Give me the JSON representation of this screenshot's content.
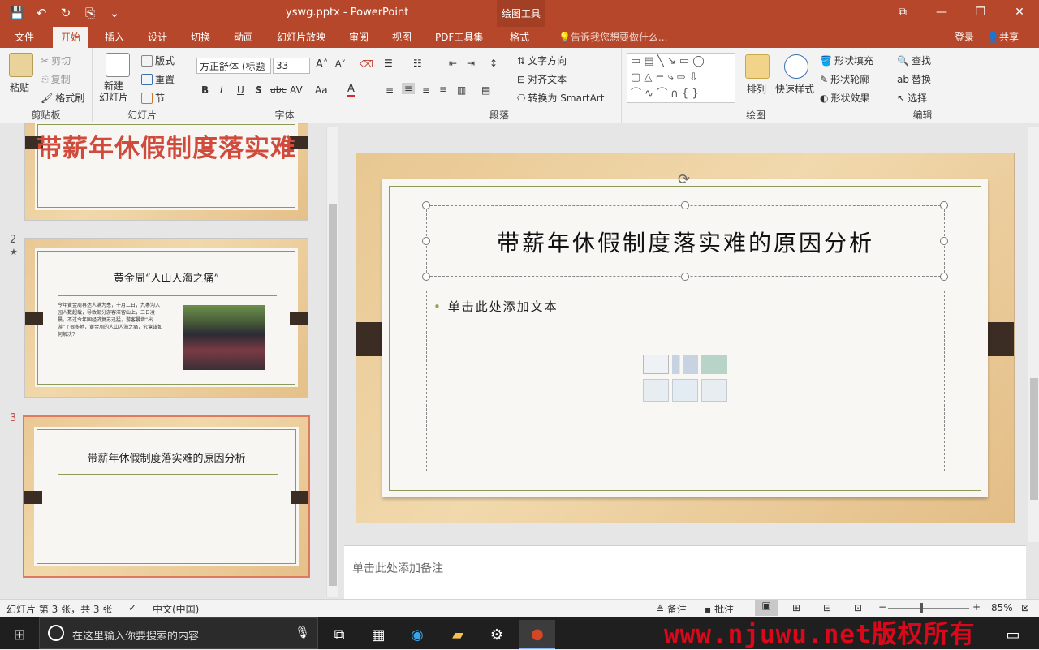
{
  "window": {
    "title": "yswg.pptx - PowerPoint",
    "context_tool": "绘图工具",
    "qat": [
      "💾",
      "↶",
      "↻",
      "⎘",
      "⌄"
    ],
    "controls": [
      "⧉",
      "—",
      "❐",
      "✕"
    ]
  },
  "tabs": [
    "文件",
    "开始",
    "插入",
    "设计",
    "切换",
    "动画",
    "幻灯片放映",
    "审阅",
    "视图",
    "PDF工具集",
    "格式"
  ],
  "active_tab": "开始",
  "tellme": "告诉我您想要做什么...",
  "login": "登录",
  "share": "共享",
  "ribbon": {
    "clipboard": {
      "label": "剪贴板",
      "paste": "粘贴",
      "cut": "剪切",
      "copy": "复制",
      "format_painter": "格式刷"
    },
    "slides": {
      "label": "幻灯片",
      "new_slide": "新建\n幻灯片",
      "layout": "版式",
      "reset": "重置",
      "section": "节"
    },
    "font": {
      "label": "字体",
      "font_name": "方正舒体 (标题",
      "font_size": "33",
      "bold": "B",
      "italic": "I",
      "underline": "U",
      "shadow": "S",
      "strike": "abc",
      "spacing": "AV",
      "case": "Aa",
      "color": "A"
    },
    "paragraph": {
      "label": "段落",
      "text_direction": "文字方向",
      "align_text": "对齐文本",
      "convert_smartart": "转换为 SmartArt"
    },
    "drawing": {
      "label": "绘图",
      "arrange": "排列",
      "quick_styles": "快速样式",
      "shape_fill": "形状填充",
      "shape_outline": "形状轮廓",
      "shape_effects": "形状效果"
    },
    "editing": {
      "label": "编辑",
      "find": "查找",
      "replace": "替换",
      "select": "选择"
    }
  },
  "thumbnails": [
    {
      "num": "",
      "title": "带薪年休假制度落实难"
    },
    {
      "num": "2",
      "star": "★",
      "title": "黄金周“人山人海之痛”",
      "body": "今年黄金周再达人满为患，十月二日，九寨沟入园人数超载，导致部分游客滞留山上，三日凌晨。不过今年国经济复苏迅猛，游客暴增“出游”了很多地，黄金周的人山人海之痛，究竟该如何解决？"
    },
    {
      "num": "3",
      "title": "带薪年休假制度落实难的原因分析"
    }
  ],
  "slide": {
    "title": "带薪年休假制度落实难的原因分析",
    "bullet": "单击此处添加文本"
  },
  "notes_placeholder": "单击此处添加备注",
  "status": {
    "slide_info": "幻灯片 第 3 张，共 3 张",
    "language": "中文(中国)",
    "notes": "备注",
    "comments": "批注",
    "zoom": "85%"
  },
  "taskbar": {
    "search_placeholder": "在这里输入你要搜索的内容"
  },
  "watermark": "www.njuwu.net版权所有",
  "colors": {
    "accent": "#b7472a",
    "frame": "#8e9a5a",
    "clip": "#3b2c24"
  }
}
